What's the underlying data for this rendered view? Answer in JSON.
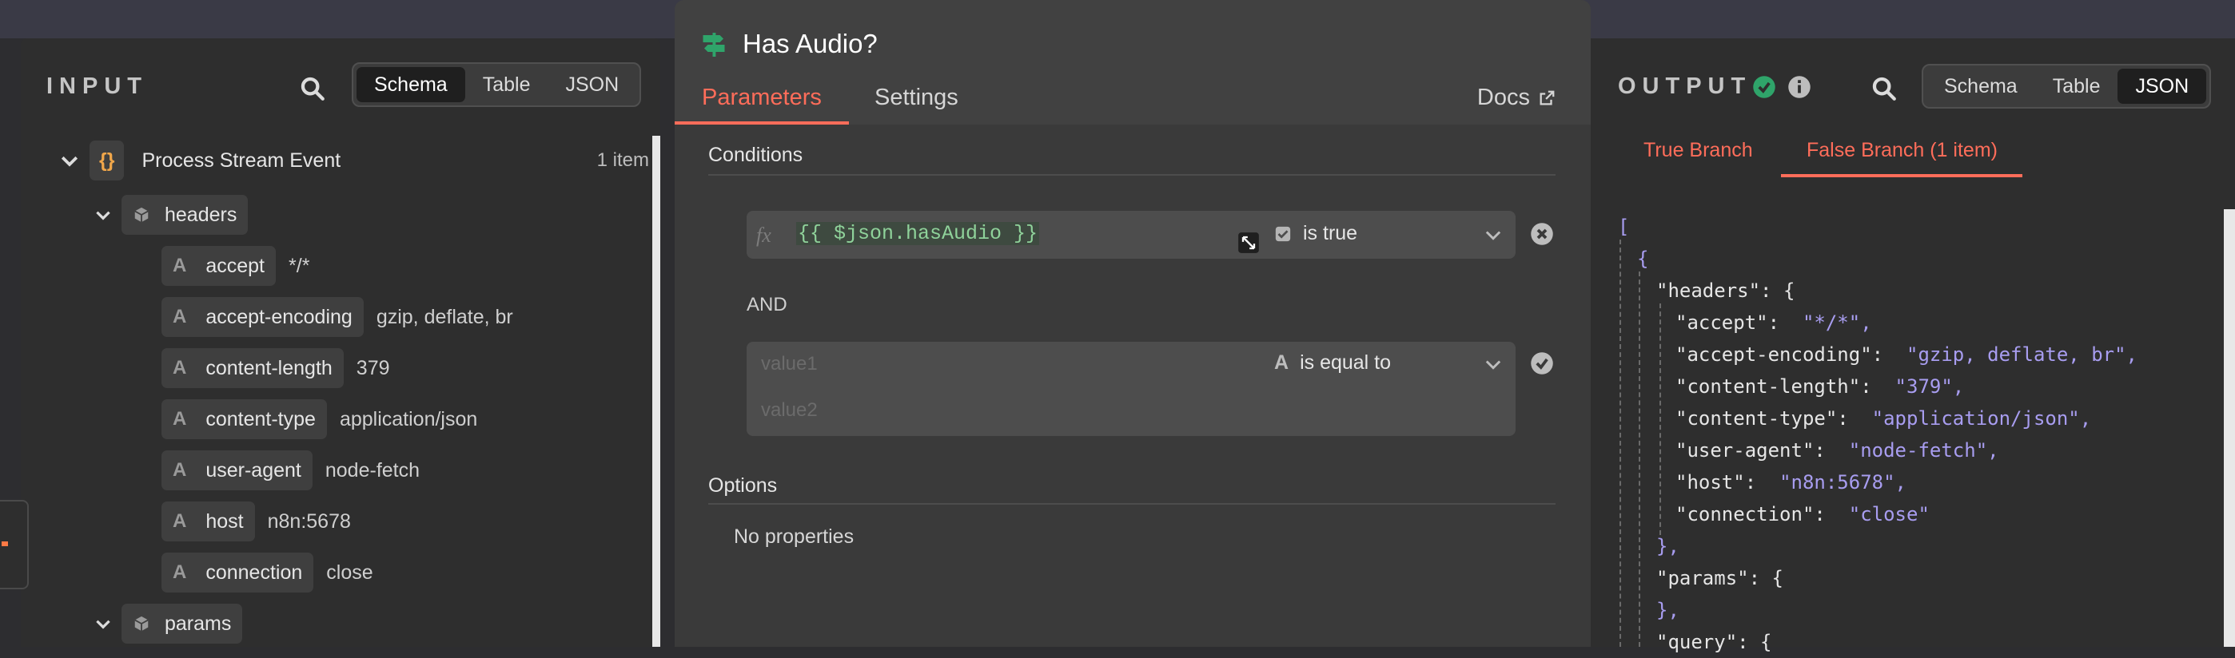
{
  "input": {
    "title": "INPUT",
    "tabs": [
      "Schema",
      "Table",
      "JSON"
    ],
    "active_tab": "Schema",
    "root": {
      "label": "Process Stream Event",
      "count": "1 item"
    },
    "headers_label": "headers",
    "fields": [
      {
        "key": "accept",
        "value": "*/*"
      },
      {
        "key": "accept-encoding",
        "value": "gzip, deflate, br"
      },
      {
        "key": "content-length",
        "value": "379"
      },
      {
        "key": "content-type",
        "value": "application/json"
      },
      {
        "key": "user-agent",
        "value": "node-fetch"
      },
      {
        "key": "host",
        "value": "n8n:5678"
      },
      {
        "key": "connection",
        "value": "close"
      }
    ],
    "params_label": "params",
    "type_glyph": "A",
    "root_glyph": "{}"
  },
  "node": {
    "title": "Has Audio?",
    "tabs": {
      "parameters": "Parameters",
      "settings": "Settings"
    },
    "docs": "Docs",
    "conditions_label": "Conditions",
    "condition1": {
      "fx": "fx",
      "expression": "{{ $json.hasAudio }}",
      "operator": "is true"
    },
    "combinator": "AND",
    "condition2": {
      "value1_placeholder": "value1",
      "value2_placeholder": "value2",
      "operator": "is equal to",
      "type_glyph": "A"
    },
    "options_label": "Options",
    "no_properties": "No properties"
  },
  "output": {
    "title": "OUTPUT",
    "tabs": [
      "Schema",
      "Table",
      "JSON"
    ],
    "active_tab": "JSON",
    "branches": {
      "true": "True Branch",
      "false": "False Branch (1 item)"
    },
    "json_lines": [
      "[",
      "{",
      "\"headers\": {",
      "\"accept\":",
      "\"*/*\",",
      "\"accept-encoding\":",
      "\"gzip, deflate, br\",",
      "\"content-length\":",
      "\"379\",",
      "\"content-type\":",
      "\"application/json\",",
      "\"user-agent\":",
      "\"node-fetch\",",
      "\"host\":",
      "\"n8n:5678\",",
      "\"connection\":",
      "\"close\"",
      "},",
      "\"params\": {",
      "},",
      "\"query\": {"
    ]
  },
  "colors": {
    "accent": "#ff6d5a",
    "success": "#2fa46a",
    "json_value": "#a89df0",
    "expression": "#8fd29a"
  }
}
